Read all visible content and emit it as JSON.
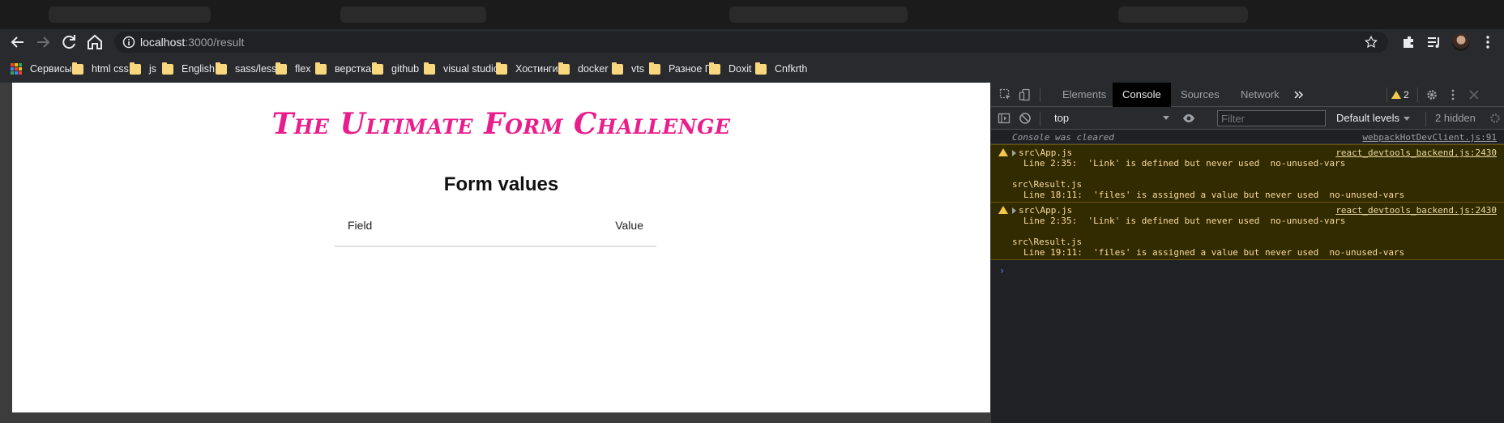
{
  "browser": {
    "url_host": "localhost",
    "url_path": ":3000/result",
    "extensions_badge": ""
  },
  "bookmarks": [
    {
      "label": "Сервисы",
      "type": "apps"
    },
    {
      "label": "html css",
      "type": "folder"
    },
    {
      "label": "js",
      "type": "folder"
    },
    {
      "label": "English",
      "type": "folder"
    },
    {
      "label": "sass/less",
      "type": "folder"
    },
    {
      "label": "flex",
      "type": "folder"
    },
    {
      "label": "верстка",
      "type": "folder"
    },
    {
      "label": "github",
      "type": "folder"
    },
    {
      "label": "visual studio",
      "type": "folder"
    },
    {
      "label": "Хостинги",
      "type": "folder"
    },
    {
      "label": "docker",
      "type": "folder"
    },
    {
      "label": "vts",
      "type": "folder"
    },
    {
      "label": "Разное Г",
      "type": "folder"
    },
    {
      "label": "Doxit",
      "type": "folder"
    },
    {
      "label": "Cnfkrth",
      "type": "folder"
    }
  ],
  "page": {
    "app_title": "The Ultimate Form Challenge",
    "heading": "Form values",
    "table_headers": [
      "Field",
      "Value"
    ],
    "title_color": "#e91e8c"
  },
  "devtools": {
    "tabs": [
      "Elements",
      "Console",
      "Sources",
      "Network"
    ],
    "active_tab": "Console",
    "warnings_count": "2",
    "context": "top",
    "filter_placeholder": "Filter",
    "levels": "Default levels",
    "hidden": "2 hidden",
    "console": {
      "cleared_text": "Console was cleared",
      "cleared_source": "webpackHotDevClient.js:91",
      "warnings": [
        {
          "source": "react_devtools_backend.js:2430",
          "file1": "src\\App.js",
          "line1": "Line 2:35:  'Link' is defined but never used  no-unused-vars",
          "file2": "src\\Result.js",
          "line2": "Line 18:11:  'files' is assigned a value but never used  no-unused-vars"
        },
        {
          "source": "react_devtools_backend.js:2430",
          "file1": "src\\App.js",
          "line1": "Line 2:35:  'Link' is defined but never used  no-unused-vars",
          "file2": "src\\Result.js",
          "line2": "Line 19:11:  'files' is assigned a value but never used  no-unused-vars"
        }
      ]
    }
  }
}
